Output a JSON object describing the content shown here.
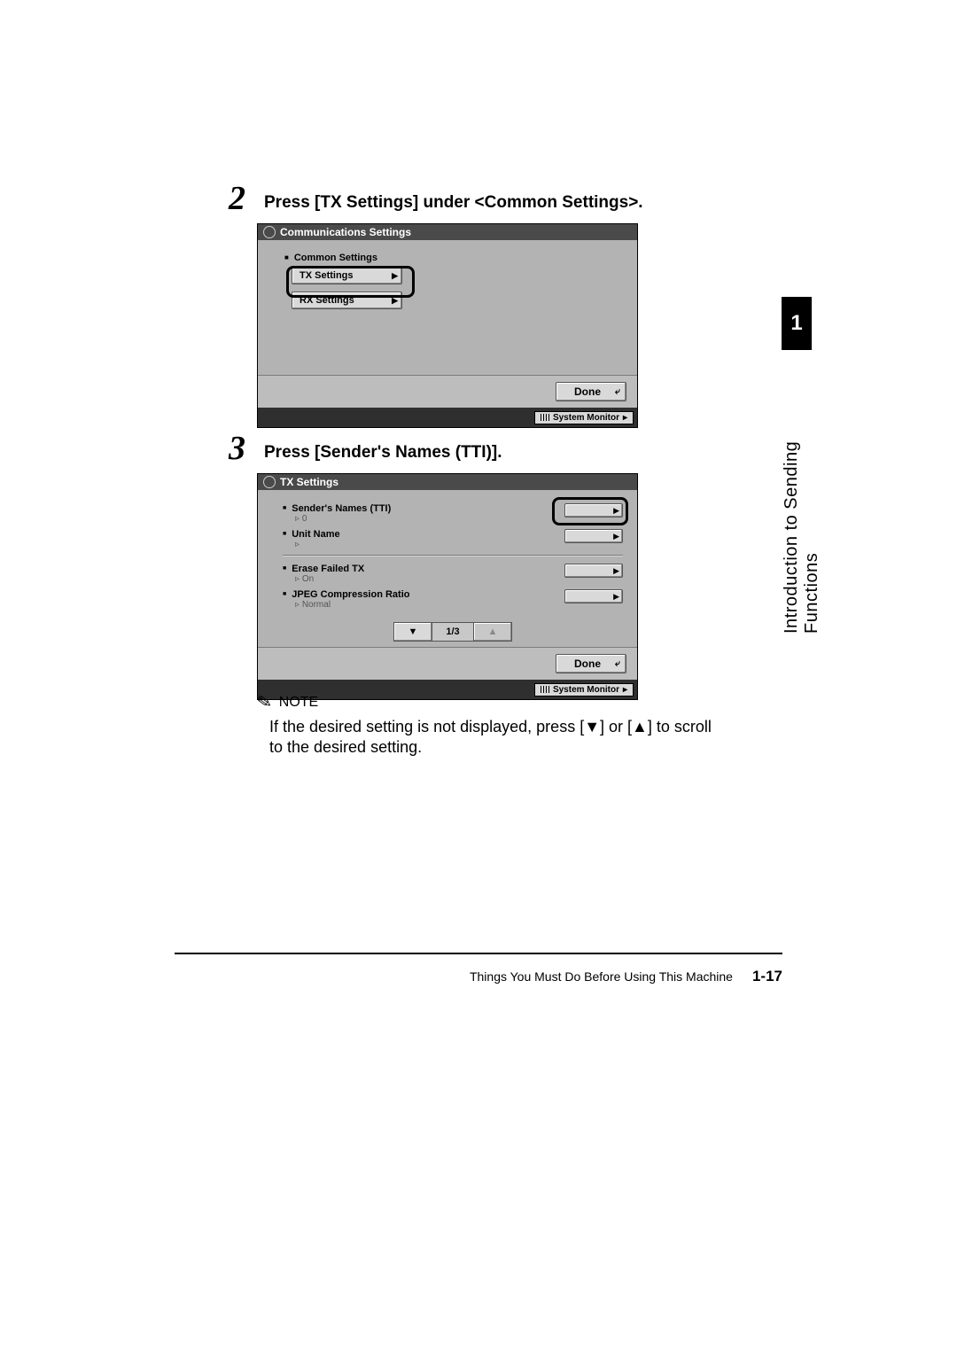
{
  "sideTab": {
    "chapter_number": "1",
    "chapter_title": "Introduction to Sending Functions"
  },
  "steps": [
    {
      "num": "2",
      "text": "Press [TX Settings] under <Common Settings>."
    },
    {
      "num": "3",
      "text": "Press [Sender's Names (TTI)]."
    }
  ],
  "screen1": {
    "title": "Communications Settings",
    "group_label": "Common Settings",
    "buttons": {
      "tx": "TX Settings",
      "rx": "RX Settings"
    },
    "done": "Done",
    "sysmon": "System Monitor"
  },
  "screen2": {
    "title": "TX Settings",
    "rows": {
      "senders_names": {
        "label": "Sender's Names (TTI)",
        "sub": "0"
      },
      "unit_name": {
        "label": "Unit Name"
      },
      "erase_failed": {
        "label": "Erase Failed TX",
        "sub": "On"
      },
      "jpeg": {
        "label": "JPEG Compression Ratio",
        "sub": "Normal"
      }
    },
    "pager": {
      "page": "1/3"
    },
    "done": "Done",
    "sysmon": "System Monitor"
  },
  "note": {
    "heading": "NOTE",
    "text_before": "If the desired setting is not displayed, press [",
    "text_middle": "] or [",
    "text_after": "] to scroll to the desired setting."
  },
  "footer": {
    "section": "Things You Must Do Before Using This Machine",
    "page": "1-17"
  }
}
